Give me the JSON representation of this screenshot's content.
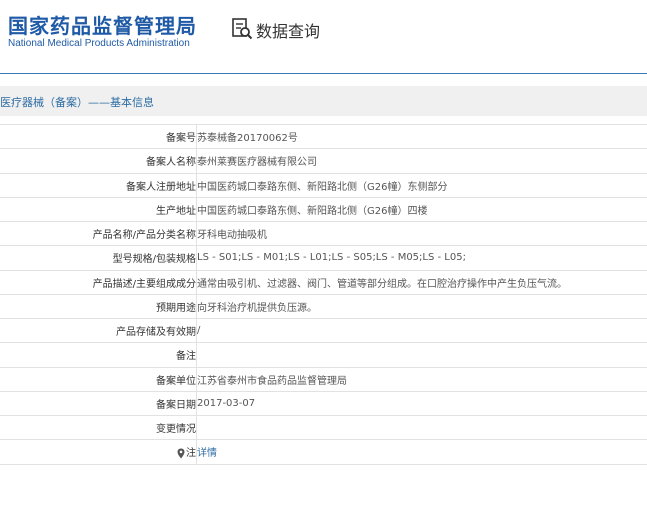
{
  "header": {
    "logo_cn": "国家药品监督管理局",
    "logo_en": "National Medical Products Administration",
    "query_title": "数据查询"
  },
  "breadcrumb": "医疗器械（备案）——基本信息",
  "rows": [
    {
      "label": "备案号",
      "value": "苏泰械备20170062号"
    },
    {
      "label": "备案人名称",
      "value": "泰州莱赛医疗器械有限公司"
    },
    {
      "label": "备案人注册地址",
      "value": "中国医药城口泰路东侧、新阳路北侧（G26幢）东侧部分"
    },
    {
      "label": "生产地址",
      "value": "中国医药城口泰路东侧、新阳路北侧（G26幢）四楼"
    },
    {
      "label": "产品名称/产品分类名称",
      "value": "牙科电动抽吸机"
    },
    {
      "label": "型号规格/包装规格",
      "value": "LS - S01;LS - M01;LS - L01;LS - S05;LS - M05;LS - L05;"
    },
    {
      "label": "产品描述/主要组成成分",
      "value": "通常由吸引机、过滤器、阀门、管道等部分组成。在口腔治疗操作中产生负压气流。"
    },
    {
      "label": "预期用途",
      "value": "向牙科治疗机提供负压源。"
    },
    {
      "label": "产品存储及有效期",
      "value": "/"
    },
    {
      "label": "备注",
      "value": ""
    },
    {
      "label": "备案单位",
      "value": "江苏省泰州市食品药品监督管理局"
    },
    {
      "label": "备案日期",
      "value": "2017-03-07"
    },
    {
      "label": "变更情况",
      "value": ""
    },
    {
      "label": "注",
      "value": "详情",
      "icon": "location-pin-icon"
    }
  ],
  "colors": {
    "brand": "#1f5aa6",
    "link": "#2e6da4"
  }
}
